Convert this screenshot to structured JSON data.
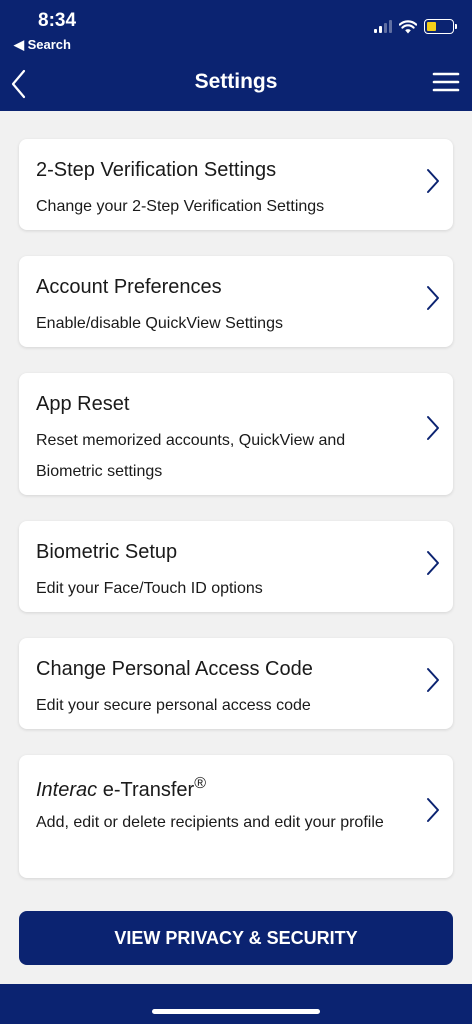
{
  "status_bar": {
    "time": "8:34",
    "back_label": "◀ Search"
  },
  "nav": {
    "title": "Settings"
  },
  "settings": [
    {
      "title": "2-Step Verification Settings",
      "description": "Change your 2-Step Verification Settings"
    },
    {
      "title": "Account Preferences",
      "description": "Enable/disable QuickView Settings"
    },
    {
      "title": "App Reset",
      "description": "Reset memorized accounts, QuickView and Biometric settings"
    },
    {
      "title": "Biometric Setup",
      "description": "Edit your Face/Touch ID options"
    },
    {
      "title": "Change Personal Access Code",
      "description": "Edit your secure personal access code"
    },
    {
      "title_italic": "Interac",
      "title_rest": " e-Transfer",
      "title_mark": "®",
      "description": "Add, edit or delete recipients and edit your profile"
    }
  ],
  "privacy_button": "VIEW PRIVACY & SECURITY",
  "colors": {
    "primary": "#0b2371",
    "background": "#f1f1f1",
    "battery": "#f3cf1a"
  }
}
